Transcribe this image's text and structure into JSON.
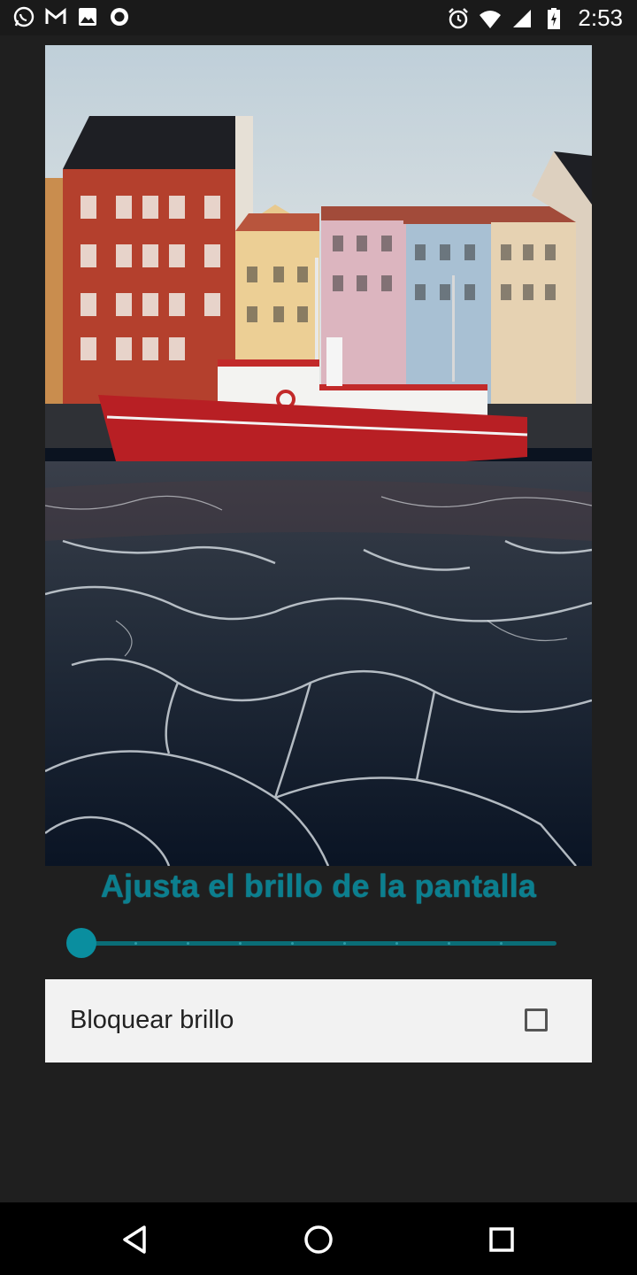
{
  "status_bar": {
    "time": "2:53",
    "left_icons": [
      "whatsapp-icon",
      "gmail-icon",
      "gallery-icon",
      "record-icon"
    ],
    "right_icons": [
      "alarm-icon",
      "wifi-icon",
      "signal-icon",
      "battery-icon"
    ]
  },
  "main": {
    "title": "Ajusta el brillo de la pantalla",
    "brightness_level": 0,
    "lock_label": "Bloquear brillo",
    "lock_checked": false
  },
  "colors": {
    "accent": "#0a8e9f",
    "title": "#0b7f8f",
    "background": "#1f1f1f",
    "card": "#f2f2f2"
  },
  "nav_bar": {
    "buttons": [
      "back-icon",
      "home-icon",
      "recents-icon"
    ]
  }
}
